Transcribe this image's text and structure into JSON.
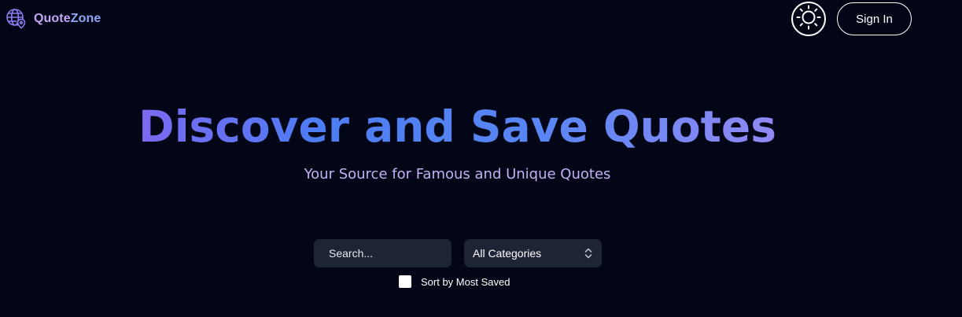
{
  "header": {
    "brand_part1": "Quote",
    "brand_part2": "Zone",
    "logo_icon": "globe-location-icon",
    "theme_toggle_icon": "sun-icon",
    "signin_label": "Sign In"
  },
  "hero": {
    "title": "Discover and Save Quotes",
    "subtitle": "Your Source for Famous and Unique Quotes"
  },
  "filters": {
    "search_placeholder": "Search...",
    "category_selected": "All Categories",
    "category_icon": "chevron-up-down-icon",
    "sort_label": "Sort by Most Saved",
    "sort_checked": false
  },
  "colors": {
    "background": "#030617",
    "accent_purple": "#a158f0",
    "accent_blue": "#4c7df2",
    "input_bg": "#1d2535"
  }
}
